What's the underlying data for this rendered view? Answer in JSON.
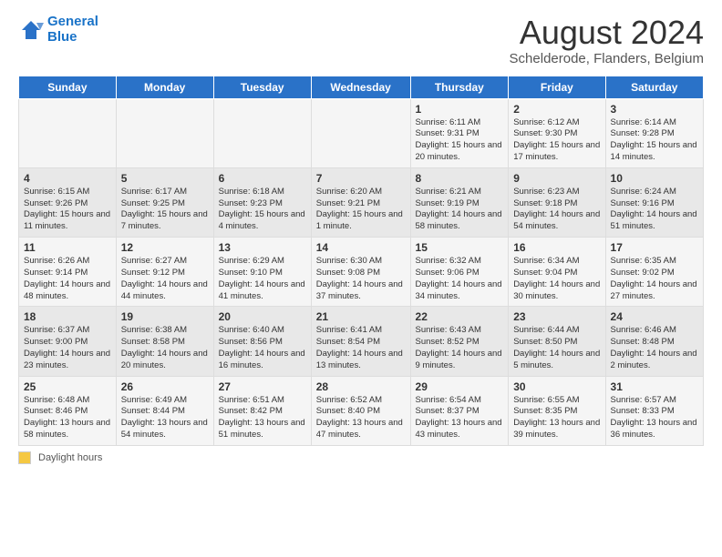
{
  "header": {
    "logo_line1": "General",
    "logo_line2": "Blue",
    "title": "August 2024",
    "subtitle": "Schelderode, Flanders, Belgium"
  },
  "days_of_week": [
    "Sunday",
    "Monday",
    "Tuesday",
    "Wednesday",
    "Thursday",
    "Friday",
    "Saturday"
  ],
  "weeks": [
    [
      {
        "num": "",
        "info": ""
      },
      {
        "num": "",
        "info": ""
      },
      {
        "num": "",
        "info": ""
      },
      {
        "num": "",
        "info": ""
      },
      {
        "num": "1",
        "info": "Sunrise: 6:11 AM\nSunset: 9:31 PM\nDaylight: 15 hours\nand 20 minutes."
      },
      {
        "num": "2",
        "info": "Sunrise: 6:12 AM\nSunset: 9:30 PM\nDaylight: 15 hours\nand 17 minutes."
      },
      {
        "num": "3",
        "info": "Sunrise: 6:14 AM\nSunset: 9:28 PM\nDaylight: 15 hours\nand 14 minutes."
      }
    ],
    [
      {
        "num": "4",
        "info": "Sunrise: 6:15 AM\nSunset: 9:26 PM\nDaylight: 15 hours\nand 11 minutes."
      },
      {
        "num": "5",
        "info": "Sunrise: 6:17 AM\nSunset: 9:25 PM\nDaylight: 15 hours\nand 7 minutes."
      },
      {
        "num": "6",
        "info": "Sunrise: 6:18 AM\nSunset: 9:23 PM\nDaylight: 15 hours\nand 4 minutes."
      },
      {
        "num": "7",
        "info": "Sunrise: 6:20 AM\nSunset: 9:21 PM\nDaylight: 15 hours\nand 1 minute."
      },
      {
        "num": "8",
        "info": "Sunrise: 6:21 AM\nSunset: 9:19 PM\nDaylight: 14 hours\nand 58 minutes."
      },
      {
        "num": "9",
        "info": "Sunrise: 6:23 AM\nSunset: 9:18 PM\nDaylight: 14 hours\nand 54 minutes."
      },
      {
        "num": "10",
        "info": "Sunrise: 6:24 AM\nSunset: 9:16 PM\nDaylight: 14 hours\nand 51 minutes."
      }
    ],
    [
      {
        "num": "11",
        "info": "Sunrise: 6:26 AM\nSunset: 9:14 PM\nDaylight: 14 hours\nand 48 minutes."
      },
      {
        "num": "12",
        "info": "Sunrise: 6:27 AM\nSunset: 9:12 PM\nDaylight: 14 hours\nand 44 minutes."
      },
      {
        "num": "13",
        "info": "Sunrise: 6:29 AM\nSunset: 9:10 PM\nDaylight: 14 hours\nand 41 minutes."
      },
      {
        "num": "14",
        "info": "Sunrise: 6:30 AM\nSunset: 9:08 PM\nDaylight: 14 hours\nand 37 minutes."
      },
      {
        "num": "15",
        "info": "Sunrise: 6:32 AM\nSunset: 9:06 PM\nDaylight: 14 hours\nand 34 minutes."
      },
      {
        "num": "16",
        "info": "Sunrise: 6:34 AM\nSunset: 9:04 PM\nDaylight: 14 hours\nand 30 minutes."
      },
      {
        "num": "17",
        "info": "Sunrise: 6:35 AM\nSunset: 9:02 PM\nDaylight: 14 hours\nand 27 minutes."
      }
    ],
    [
      {
        "num": "18",
        "info": "Sunrise: 6:37 AM\nSunset: 9:00 PM\nDaylight: 14 hours\nand 23 minutes."
      },
      {
        "num": "19",
        "info": "Sunrise: 6:38 AM\nSunset: 8:58 PM\nDaylight: 14 hours\nand 20 minutes."
      },
      {
        "num": "20",
        "info": "Sunrise: 6:40 AM\nSunset: 8:56 PM\nDaylight: 14 hours\nand 16 minutes."
      },
      {
        "num": "21",
        "info": "Sunrise: 6:41 AM\nSunset: 8:54 PM\nDaylight: 14 hours\nand 13 minutes."
      },
      {
        "num": "22",
        "info": "Sunrise: 6:43 AM\nSunset: 8:52 PM\nDaylight: 14 hours\nand 9 minutes."
      },
      {
        "num": "23",
        "info": "Sunrise: 6:44 AM\nSunset: 8:50 PM\nDaylight: 14 hours\nand 5 minutes."
      },
      {
        "num": "24",
        "info": "Sunrise: 6:46 AM\nSunset: 8:48 PM\nDaylight: 14 hours\nand 2 minutes."
      }
    ],
    [
      {
        "num": "25",
        "info": "Sunrise: 6:48 AM\nSunset: 8:46 PM\nDaylight: 13 hours\nand 58 minutes."
      },
      {
        "num": "26",
        "info": "Sunrise: 6:49 AM\nSunset: 8:44 PM\nDaylight: 13 hours\nand 54 minutes."
      },
      {
        "num": "27",
        "info": "Sunrise: 6:51 AM\nSunset: 8:42 PM\nDaylight: 13 hours\nand 51 minutes."
      },
      {
        "num": "28",
        "info": "Sunrise: 6:52 AM\nSunset: 8:40 PM\nDaylight: 13 hours\nand 47 minutes."
      },
      {
        "num": "29",
        "info": "Sunrise: 6:54 AM\nSunset: 8:37 PM\nDaylight: 13 hours\nand 43 minutes."
      },
      {
        "num": "30",
        "info": "Sunrise: 6:55 AM\nSunset: 8:35 PM\nDaylight: 13 hours\nand 39 minutes."
      },
      {
        "num": "31",
        "info": "Sunrise: 6:57 AM\nSunset: 8:33 PM\nDaylight: 13 hours\nand 36 minutes."
      }
    ]
  ],
  "footer": {
    "legend_label": "Daylight hours"
  }
}
